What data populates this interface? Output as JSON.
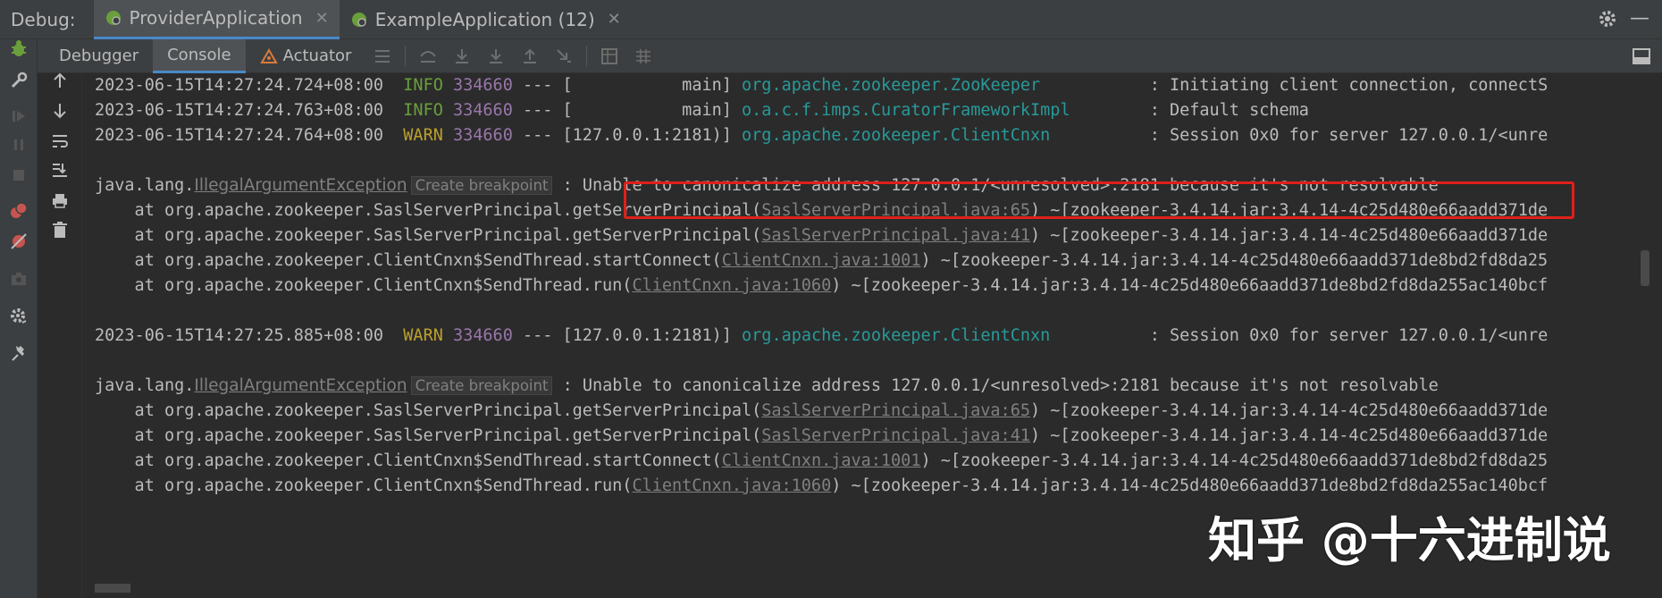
{
  "topbar": {
    "debug_label": "Debug:",
    "tabs": [
      {
        "label": "ProviderApplication",
        "active": true
      },
      {
        "label": "ExampleApplication (12)",
        "active": false
      }
    ]
  },
  "toolbar": {
    "tabs": [
      {
        "label": "Debugger"
      },
      {
        "label": "Console"
      },
      {
        "label": "Actuator"
      }
    ]
  },
  "colors": {
    "info": "#6a9f3b",
    "warn": "#bba02c",
    "pid": "#9876aa",
    "logger": "#299999",
    "highlight": "#e0201a"
  },
  "log": [
    {
      "ts": "2023-06-15T14:27:24.724+08:00",
      "level": "INFO",
      "pid": "334660",
      "sep": "---",
      "thread": "[           main]",
      "logger": "org.apache.zookeeper.ZooKeeper",
      "msg": ": Initiating client connection, connectS"
    },
    {
      "ts": "2023-06-15T14:27:24.763+08:00",
      "level": "INFO",
      "pid": "334660",
      "sep": "---",
      "thread": "[           main]",
      "logger": "o.a.c.f.imps.CuratorFrameworkImpl",
      "msg": ": Default schema"
    },
    {
      "ts": "2023-06-15T14:27:24.764+08:00",
      "level": "WARN",
      "pid": "334660",
      "sep": "---",
      "thread": "[127.0.0.1:2181)]",
      "logger": "org.apache.zookeeper.ClientCnxn",
      "msg": ": Session 0x0 for server 127.0.0.1/<unre"
    },
    {
      "ts": "2023-06-15T14:27:25.885+08:00",
      "level": "WARN",
      "pid": "334660",
      "sep": "---",
      "thread": "[127.0.0.1:2181)]",
      "logger": "org.apache.zookeeper.ClientCnxn",
      "msg": ": Session 0x0 for server 127.0.0.1/<unre"
    }
  ],
  "exception": {
    "prefix": "java.lang.",
    "name": "IllegalArgumentException",
    "create_bp": "Create breakpoint",
    "colon": " :",
    "message": "Unable to canonicalize address 127.0.0.1/<unresolved>:2181 because it's not resolvable",
    "message2": ": Unable to canonicalize address 127.0.0.1/<unresolved>:2181 because it's not resolvable"
  },
  "stack": [
    {
      "at": "    at org.apache.zookeeper.SaslServerPrincipal.getServerPrincipal(",
      "file": "SaslServerPrincipal.java:65",
      "tail": ") ~[zookeeper-3.4.14.jar:3.4.14-4c25d480e66aadd371de"
    },
    {
      "at": "    at org.apache.zookeeper.SaslServerPrincipal.getServerPrincipal(",
      "file": "SaslServerPrincipal.java:41",
      "tail": ") ~[zookeeper-3.4.14.jar:3.4.14-4c25d480e66aadd371de"
    },
    {
      "at": "    at org.apache.zookeeper.ClientCnxn$SendThread.startConnect(",
      "file": "ClientCnxn.java:1001",
      "tail": ") ~[zookeeper-3.4.14.jar:3.4.14-4c25d480e66aadd371de8bd2fd8da25"
    },
    {
      "at": "    at org.apache.zookeeper.ClientCnxn$SendThread.run(",
      "file": "ClientCnxn.java:1060",
      "tail": ") ~[zookeeper-3.4.14.jar:3.4.14-4c25d480e66aadd371de8bd2fd8da255ac140bcf"
    }
  ],
  "watermark": "知乎 @十六进制说"
}
